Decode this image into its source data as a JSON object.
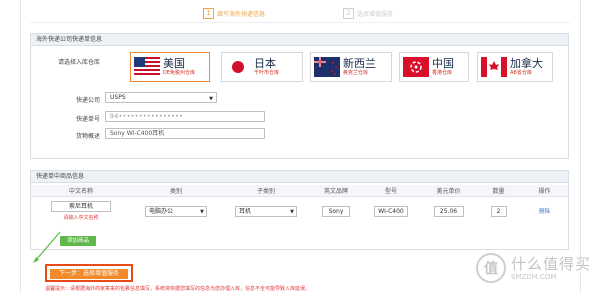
{
  "steps": [
    {
      "num": "1",
      "label": "填写海外快递信息",
      "active": true
    },
    {
      "num": "2",
      "label": "选择增值服务",
      "active": false
    }
  ],
  "shipment_panel": {
    "title": "海外快递公司快递单信息",
    "warehouse_label": "请选择入库仓库",
    "warehouses": [
      {
        "name": "美国",
        "sub": "DE免税州仓库",
        "selected": true,
        "flag": "us-flag-icon"
      },
      {
        "name": "日本",
        "sub": "千叶市仓库",
        "selected": false,
        "flag": "japan-flag-icon"
      },
      {
        "name": "新西兰",
        "sub": "奥克兰仓库",
        "selected": false,
        "flag": "nz-flag-icon"
      },
      {
        "name": "中国",
        "sub": "香港仓库",
        "selected": false,
        "flag": "hk-flag-icon"
      },
      {
        "name": "加拿大",
        "sub": "AB省仓库",
        "selected": false,
        "flag": "canada-flag-icon"
      }
    ],
    "carrier_label": "快递公司",
    "carrier_value": "USPS",
    "tracking_label": "快递单号",
    "tracking_value": "94••••••••••••••••",
    "cargo_label": "货物概述",
    "cargo_value": "Sony WI-C400耳机"
  },
  "goods_panel": {
    "title": "快递单中商品信息",
    "columns": [
      "中文名称",
      "类别",
      "子类别",
      "英文品牌",
      "型号",
      "美元单价",
      "数量",
      "操作"
    ],
    "row": {
      "name": "索尼耳机",
      "name_error": "请输入中文名称",
      "category": "电脑办公",
      "subcategory": "耳机",
      "brand": "Sony",
      "model": "WI-C400",
      "price": "25.06",
      "qty": "2",
      "action": "删除"
    },
    "add_label": "添加商品"
  },
  "next_button": "下一步：选择增值服务",
  "notice": "温馨提示：请根据海外商家寄来的包裹信息填写，系统将依据您填写的信息为您办理入库，信息不全可能导致入库延误。",
  "watermark": {
    "title": "什么值得买",
    "sub": "SMZDM.COM",
    "logo": "值"
  },
  "colors": {
    "accent": "#f08a2a",
    "highlight": "#e84a1a",
    "add": "#5fb84a",
    "error": "#e03a3a"
  }
}
